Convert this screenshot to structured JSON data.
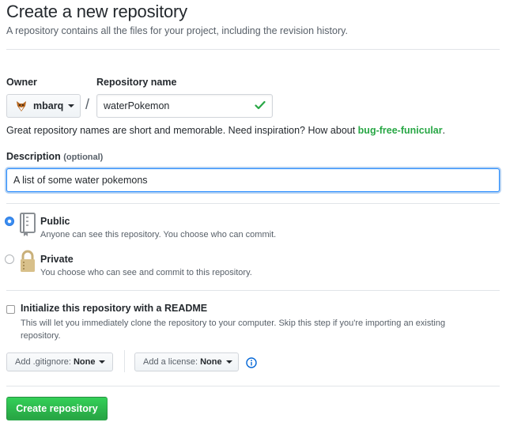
{
  "header": {
    "title": "Create a new repository",
    "subtitle": "A repository contains all the files for your project, including the revision history."
  },
  "form": {
    "owner_label": "Owner",
    "owner_value": "mbarq",
    "owner_avatar_icon": "fox-avatar-icon",
    "separator": "/",
    "repo_name_label": "Repository name",
    "repo_name_value": "waterPokemon",
    "repo_name_valid_icon": "check-icon",
    "hint_text": "Great repository names are short and memorable. Need inspiration? How about ",
    "hint_suggestion": "bug-free-funicular",
    "hint_end": ".",
    "description_label": "Description",
    "description_optional": "(optional)",
    "description_value": "A list of some water pokemons"
  },
  "visibility": {
    "selected": "public",
    "public": {
      "title": "Public",
      "description": "Anyone can see this repository. You choose who can commit.",
      "icon": "repo-book-icon"
    },
    "private": {
      "title": "Private",
      "description": "You choose who can see and commit to this repository.",
      "icon": "lock-icon"
    }
  },
  "readme": {
    "checked": false,
    "title": "Initialize this repository with a README",
    "description": "This will let you immediately clone the repository to your computer. Skip this step if you're importing an existing repository."
  },
  "options": {
    "gitignore_label": "Add .gitignore:",
    "gitignore_value": "None",
    "license_label": "Add a license:",
    "license_value": "None",
    "info_icon": "info-icon"
  },
  "actions": {
    "create_label": "Create repository"
  },
  "colors": {
    "accent_blue": "#2188ff",
    "success_green": "#28a745",
    "text": "#24292e",
    "muted": "#586069"
  }
}
